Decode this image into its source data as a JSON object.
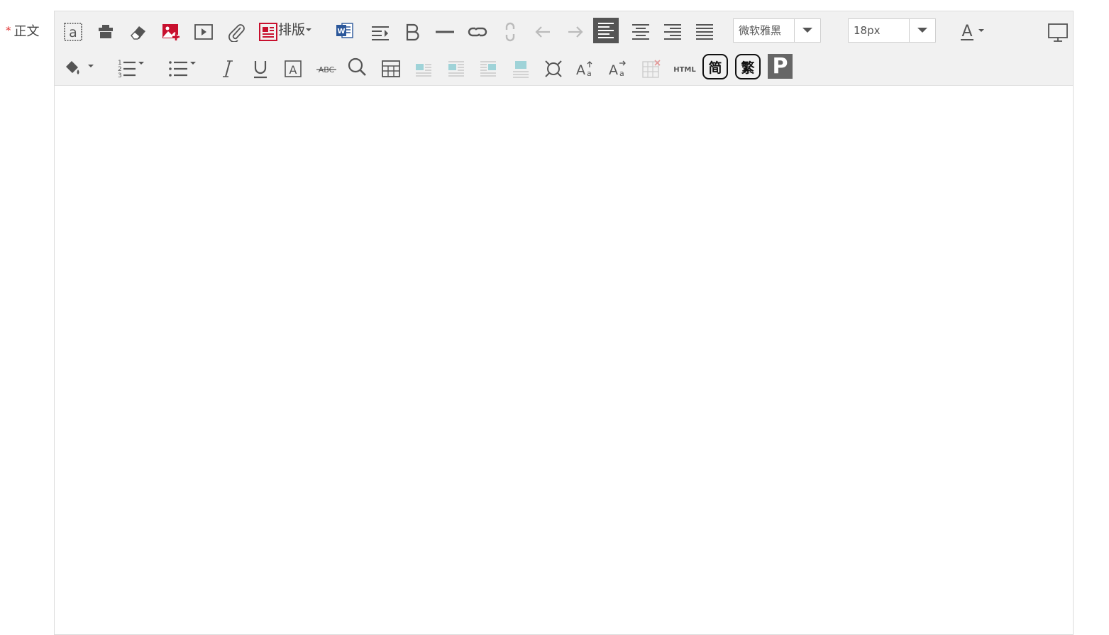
{
  "field": {
    "required_mark": "*",
    "label": "正文"
  },
  "toolbar": {
    "layout_label": "排版",
    "font_family": "微软雅黑",
    "font_size": "18px",
    "html_label": "HTML",
    "simplified_label": "简",
    "traditional_label": "繁",
    "p_label": "P",
    "row1_icons": [
      "source-icon",
      "paste-plain-icon",
      "eraser-icon",
      "insert-image-icon",
      "insert-video-icon",
      "attachment-icon",
      "layout-icon",
      "word-import-icon",
      "indent-icon",
      "bold-icon",
      "horizontal-rule-icon",
      "link-icon",
      "unlink-icon",
      "undo-icon",
      "redo-icon",
      "align-left-icon",
      "align-center-icon",
      "align-right-icon",
      "align-justify-icon",
      "font-color-icon",
      "fullscreen-icon"
    ],
    "row2_icons": [
      "background-color-icon",
      "ordered-list-icon",
      "unordered-list-icon",
      "italic-icon",
      "underline-icon",
      "border-text-icon",
      "strikethrough-icon",
      "search-icon",
      "insert-table-icon",
      "float-left-icon",
      "float-none-icon",
      "float-right-icon",
      "float-center-icon",
      "special-chars-icon",
      "uppercase-icon",
      "lowercase-icon",
      "delete-table-icon",
      "html-icon",
      "simplified-chinese-icon",
      "traditional-chinese-icon",
      "paragraph-icon"
    ]
  },
  "colors": {
    "icon": "#555555",
    "icon_disabled": "#bbbbbb",
    "accent_red": "#c8102e",
    "word_blue": "#2b579a",
    "required_red": "#e0312f",
    "toolbar_bg": "#f1f1f1",
    "float_teal": "#9fd3d8"
  }
}
